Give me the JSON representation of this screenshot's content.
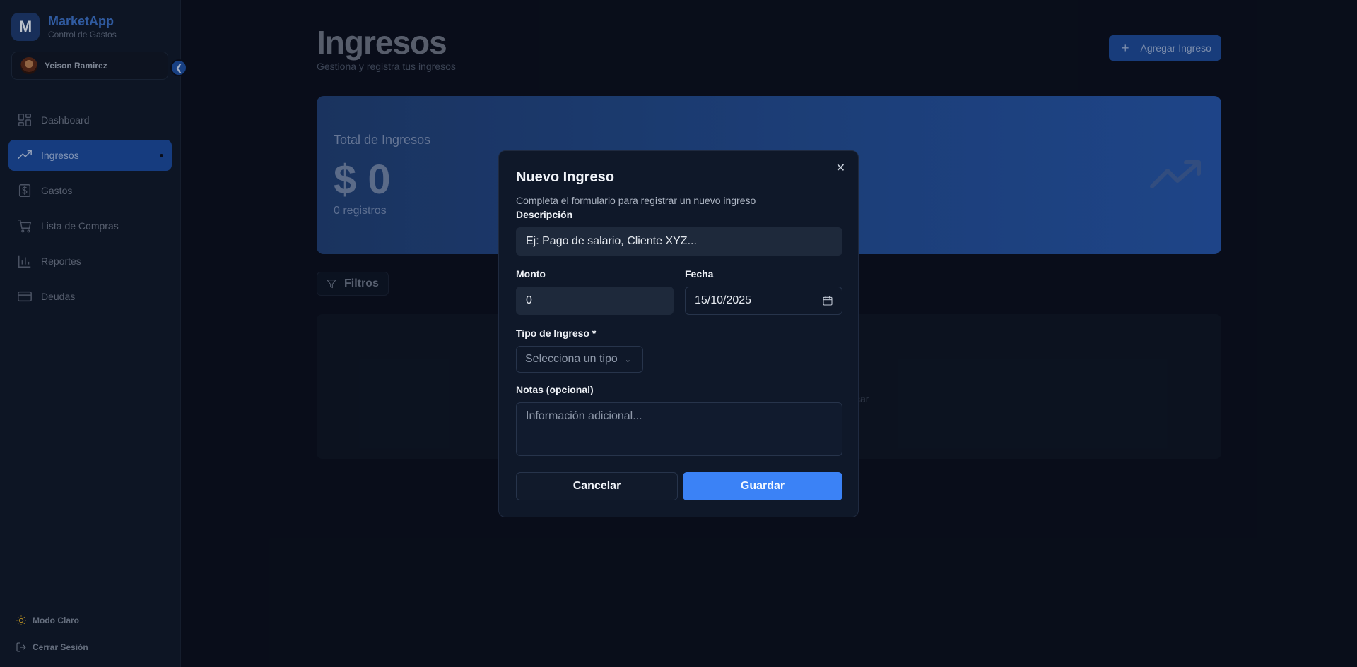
{
  "brand": {
    "logo_letter": "M",
    "name": "MarketApp",
    "subtitle": "Control de Gastos"
  },
  "user": {
    "name": "Yeison Ramirez"
  },
  "sidebar": {
    "collapse_icon": "chevron-left-icon",
    "items": [
      {
        "label": "Dashboard",
        "icon": "grid-icon",
        "active": false
      },
      {
        "label": "Ingresos",
        "icon": "trending-up-icon",
        "active": true
      },
      {
        "label": "Gastos",
        "icon": "dollar-square-icon",
        "active": false
      },
      {
        "label": "Lista de Compras",
        "icon": "cart-icon",
        "active": false
      },
      {
        "label": "Reportes",
        "icon": "bar-chart-icon",
        "active": false
      },
      {
        "label": "Deudas",
        "icon": "credit-card-icon",
        "active": false
      }
    ],
    "footer": {
      "theme_toggle": "Modo Claro",
      "logout": "Cerrar Sesión"
    }
  },
  "header": {
    "title": "Ingresos",
    "subtitle": "Gestiona y registra tus ingresos",
    "add_button": "Agregar Ingreso"
  },
  "summary": {
    "label": "Total de Ingresos",
    "value": "$ 0",
    "count": "0 registros"
  },
  "filters": {
    "label": "Filtros"
  },
  "empty_state": {
    "partial_text": "car"
  },
  "dialog": {
    "title": "Nuevo Ingreso",
    "subtitle": "Completa el formulario para registrar un nuevo ingreso",
    "fields": {
      "description": {
        "label": "Descripción",
        "value": "Ej: Pago de salario, Cliente XYZ..."
      },
      "amount": {
        "label": "Monto",
        "value": "0"
      },
      "date": {
        "label": "Fecha",
        "value": "15/10/2025"
      },
      "type": {
        "label": "Tipo de Ingreso *",
        "placeholder": "Selecciona un tipo"
      },
      "notes": {
        "label": "Notas (opcional)",
        "placeholder": "Información adicional..."
      }
    },
    "cancel": "Cancelar",
    "save": "Guardar"
  },
  "colors": {
    "accent": "#3b82f6",
    "active_nav": "#1c4a9c",
    "background": "#0b1120",
    "sidebar": "#111a2c",
    "dialog": "#0f1829"
  }
}
